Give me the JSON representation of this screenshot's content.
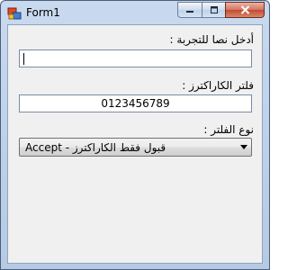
{
  "window": {
    "title": "Form1",
    "icon": "form-app-icon",
    "controls": [
      "minimize-icon",
      "maximize-icon",
      "close-icon"
    ]
  },
  "form": {
    "input_label": "أدخل نصا للتجربة :",
    "input_value": "",
    "filter_label": "فلتر الكاراكترز :",
    "filter_value": "0123456789",
    "type_label": "نوع الفلتر :",
    "type_selected": "قبول فقط الكاراكترز - Accept"
  },
  "colors": {
    "titlebar": "#c9d9ee",
    "client_bg": "#f0f0f0",
    "close_button": "#c24a33"
  }
}
